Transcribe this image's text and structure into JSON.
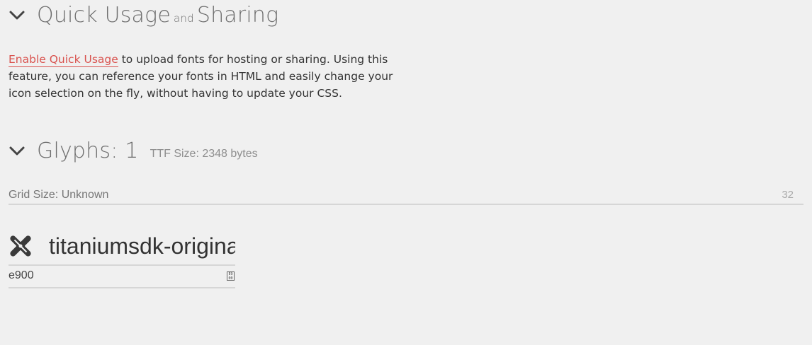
{
  "quick_usage": {
    "title_main": "Quick Usage",
    "title_and": "and",
    "title_end": "Sharing",
    "link_text": "Enable Quick Usage",
    "description": " to upload fonts for hosting or sharing. Using this feature, you can reference your fonts in HTML and easily change your icon selection on the fly, without having to update your CSS."
  },
  "glyphs": {
    "title": "Glyphs: 1",
    "ttf_size": "TTF Size: 2348 bytes",
    "grid_label": "Grid Size: Unknown",
    "grid_value": "32",
    "items": [
      {
        "name": "titaniumsdk-original",
        "code": "e900",
        "icon": "titanium-logo-icon"
      }
    ]
  },
  "code_icon_text": "E9\n00"
}
